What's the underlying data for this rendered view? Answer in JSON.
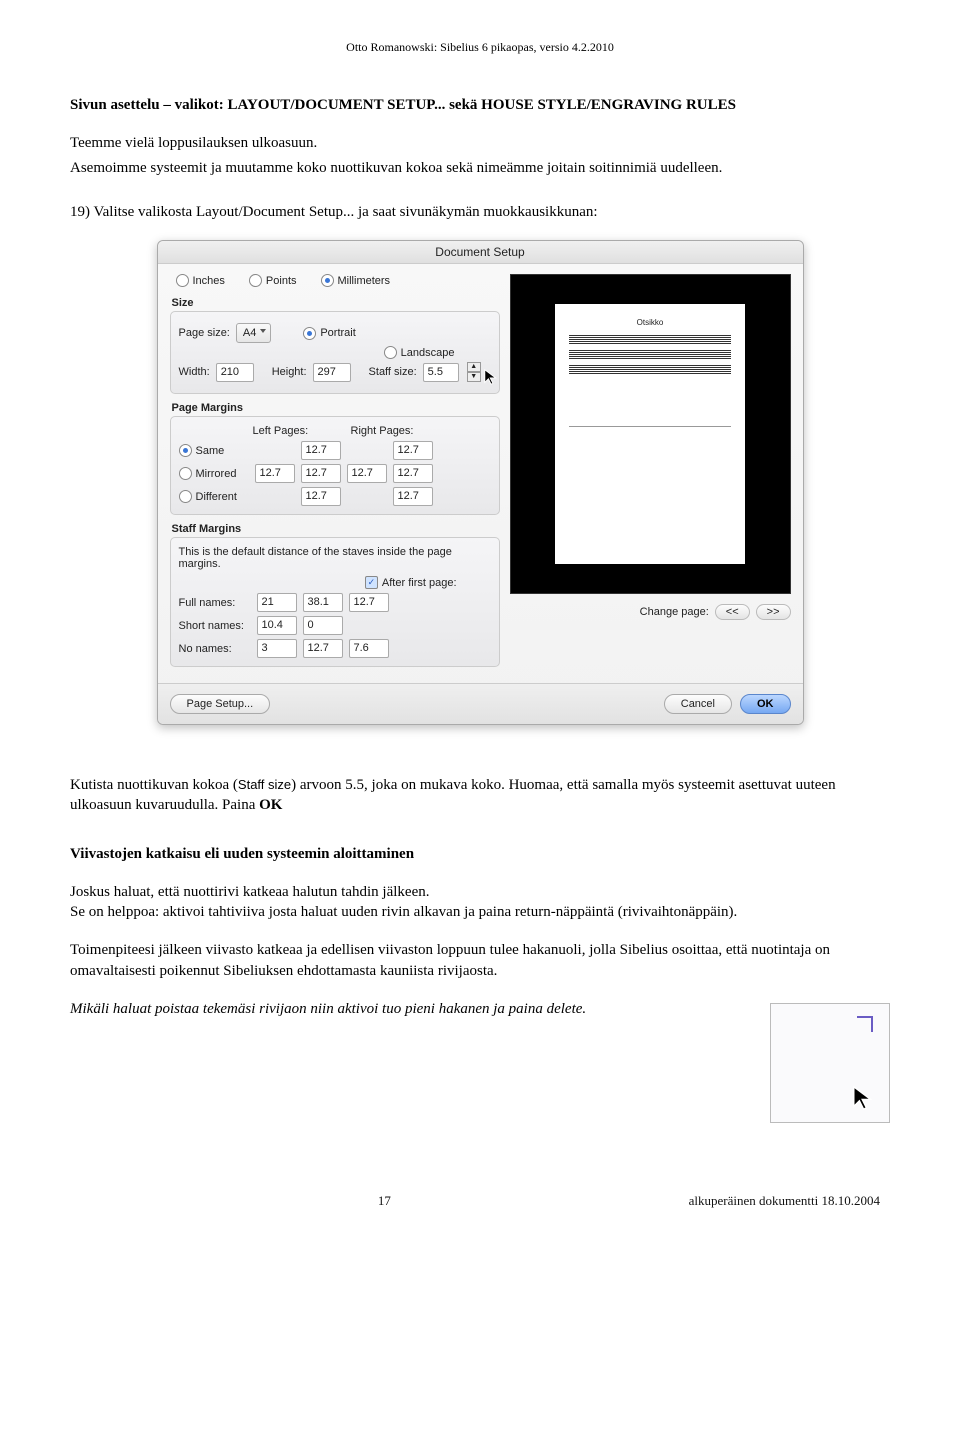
{
  "doc_header": "Otto Romanowski: Sibelius 6 pikaopas, versio 4.2.2010",
  "para_heading": "Sivun asettelu – valikot: LAYOUT/DOCUMENT SETUP... sekä HOUSE STYLE/ENGRAVING RULES",
  "para_intro1": "Teemme vielä loppusilauksen ulkoasuun.",
  "para_intro2": "Asemoimme systeemit ja muutamme koko nuottikuvan kokoa sekä nimeämme joitain soitinnimiä uudelleen.",
  "para_step": "19) Valitse valikosta Layout/Document Setup... ja saat sivunäkymän muokkausikkunan:",
  "dialog": {
    "title": "Document Setup",
    "units": {
      "inches": "Inches",
      "points": "Points",
      "millimeters": "Millimeters"
    },
    "size": {
      "label": "Size",
      "page_size_label": "Page size:",
      "page_size_value": "A4",
      "portrait": "Portrait",
      "landscape": "Landscape",
      "width_label": "Width:",
      "width_value": "210",
      "height_label": "Height:",
      "height_value": "297",
      "staff_size_label": "Staff size:",
      "staff_size_value": "5.5"
    },
    "page_margins": {
      "label": "Page Margins",
      "left_pages": "Left Pages:",
      "right_pages": "Right Pages:",
      "same": "Same",
      "mirrored": "Mirrored",
      "different": "Different",
      "values": {
        "same_l": "12.7",
        "same_r": "12.7",
        "mirr_1": "12.7",
        "mirr_2": "12.7",
        "mirr_3": "12.7",
        "mirr_4": "12.7",
        "diff_1": "12.7",
        "diff_2": "12.7"
      }
    },
    "staff_margins": {
      "label": "Staff Margins",
      "desc": "This is the default distance of the staves inside the page margins.",
      "after_first_page": "After first page:",
      "full_names_label": "Full names:",
      "full_names_value": "21",
      "short_names_label": "Short names:",
      "short_names_value": "10.4",
      "no_names_label": "No names:",
      "no_names_value": "3",
      "col2a": "38.1",
      "col2b": "0",
      "col2c": "12.7",
      "col3a": "12.7",
      "col3c": "7.6"
    },
    "preview_title": "Otsikko",
    "change_page_label": "Change page:",
    "change_prev": "<<",
    "change_next": ">>",
    "buttons": {
      "page_setup": "Page Setup...",
      "cancel": "Cancel",
      "ok": "OK"
    }
  },
  "para_after1a": "Kutista nuottikuvan kokoa (",
  "para_after1_staff": "Staff size",
  "para_after1b": ") arvoon 5.5, joka on mukava koko. Huomaa, että samalla myös systeemit asettuvat uuteen ulkoasuun kuvaruudulla. Paina ",
  "para_after1_ok": "OK",
  "viivastot_heading": "Viivastojen katkaisu eli uuden systeemin aloittaminen",
  "para_v1": "Joskus haluat, että nuottirivi katkeaa halutun tahdin jälkeen.",
  "para_v2": "Se on helppoa: aktivoi tahtiviiva josta haluat uuden rivin alkavan ja paina return-näppäintä (rivivaihtonäppäin).",
  "para_v3": "Toimenpiteesi jälkeen viivasto katkeaa ja edellisen viivaston loppuun tulee hakanuoli, jolla Sibelius osoittaa, että nuotintaja on omavaltaisesti poikennut Sibeliuksen ehdottamasta kauniista rivijaosta.",
  "para_v4": "Mikäli haluat poistaa tekemäsi rivijaon niin aktivoi tuo pieni hakanen ja paina delete.",
  "footer_page": "17",
  "footer_right": "alkuperäinen dokumentti 18.10.2004"
}
